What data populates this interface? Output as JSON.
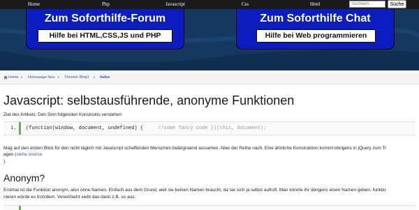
{
  "nav": {
    "items": [
      "Home",
      "Php",
      "Javascript",
      "Css",
      "Html"
    ],
    "search_placeholder": "Suchwort...",
    "search_button": "Suche"
  },
  "banner": {
    "forum_title": "Zum Soforthilfe-Forum",
    "forum_subtitle": "Hilfe bei HTML,CSS,JS und PHP",
    "chat_title": "Zum Soforthilfe Chat",
    "chat_subtitle": "Hilfe bei Web programmieren"
  },
  "breadcrumb": {
    "items": [
      "Home",
      "Homepage Neu",
      "Themen Blog1",
      "Index"
    ]
  },
  "article": {
    "title": "Javascript: selbstausführende, anonyme Funktionen",
    "intro": "Ziel des Artikels: Den Sinn folgenden Konstrukts verstehen",
    "code_line_number": "1.",
    "code": "(function(window, document, undefined) {     ",
    "code_comment": "//some fancy code })(this, document);",
    "para1_line1": "Mag auf den ersten Blick für den nicht täglich mit Javascript schaffenden Menschen beängistend aussehen. Aber der Reihe nach. Eine ähnliche Konstruktion kommt übrigens in jQuery zum Tr",
    "para1_line2_prefix": "agen (",
    "para1_link": "siehe source",
    "para1_line3": ").",
    "heading2": "Anonym?",
    "para2_line1": "Erstmal ist die Funktion anonym, also ohne Namen. Einfach aus dem Grund, weil sie keinen Namen braucht, da sie sich ja selbst aufruft. Man könnte ihr übrigens einen Namen geben, funktio",
    "para2_line2": "nieren würde es trotzdem. Vereinfacht sieht das dann z.B. so aus:"
  },
  "colors": {
    "nav_bg": "#1a1a1a",
    "banner_bg": "#14385f",
    "banner_box": "#0b1dbe",
    "link": "#2f5f9e",
    "code_bar": "#6ab04c"
  }
}
